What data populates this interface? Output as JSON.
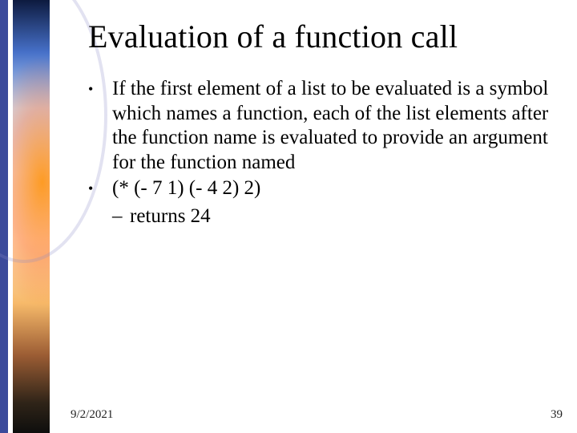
{
  "title": "Evaluation of a function call",
  "bullets": {
    "b1": "If the first element of a list to be evaluated is a symbol which names a function, each of the list elements after the function name is evaluated to provide an argument for the function named",
    "b2": "(*  (-  7  1)  (-  4  2)  2)",
    "sub1": "returns  24"
  },
  "footer": {
    "date": "9/2/2021",
    "page": "39"
  }
}
